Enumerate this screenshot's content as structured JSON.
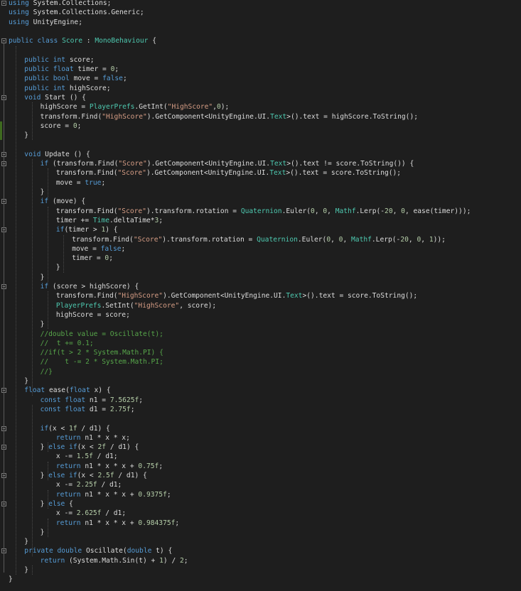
{
  "editor": {
    "language": "C#",
    "colors": {
      "background": "#1e1e1e",
      "keyword": "#569cd6",
      "type": "#4ec9b0",
      "string": "#d69d85",
      "number": "#b5cea8",
      "comment": "#57a64a",
      "plain": "#dcdcdc"
    },
    "lines": [
      {
        "indent": 0,
        "t": [
          [
            "kw",
            "using"
          ],
          [
            "pl",
            " System.Collections;"
          ]
        ]
      },
      {
        "indent": 0,
        "t": [
          [
            "kw",
            "using"
          ],
          [
            "pl",
            " System.Collections.Generic;"
          ]
        ]
      },
      {
        "indent": 0,
        "t": [
          [
            "kw",
            "using"
          ],
          [
            "pl",
            " UnityEngine;"
          ]
        ]
      },
      {
        "indent": 0,
        "t": []
      },
      {
        "indent": 0,
        "t": [
          [
            "kw",
            "public"
          ],
          [
            "pl",
            " "
          ],
          [
            "kw",
            "class"
          ],
          [
            "pl",
            " "
          ],
          [
            "ty",
            "Score"
          ],
          [
            "pl",
            " : "
          ],
          [
            "ty",
            "MonoBehaviour"
          ],
          [
            "pl",
            " {"
          ]
        ]
      },
      {
        "indent": 0,
        "t": []
      },
      {
        "indent": 1,
        "t": [
          [
            "kw",
            "public"
          ],
          [
            "pl",
            " "
          ],
          [
            "kw",
            "int"
          ],
          [
            "pl",
            " score;"
          ]
        ]
      },
      {
        "indent": 1,
        "t": [
          [
            "kw",
            "public"
          ],
          [
            "pl",
            " "
          ],
          [
            "kw",
            "float"
          ],
          [
            "pl",
            " timer = "
          ],
          [
            "nu",
            "0"
          ],
          [
            "pl",
            ";"
          ]
        ]
      },
      {
        "indent": 1,
        "t": [
          [
            "kw",
            "public"
          ],
          [
            "pl",
            " "
          ],
          [
            "kw",
            "bool"
          ],
          [
            "pl",
            " move = "
          ],
          [
            "kw",
            "false"
          ],
          [
            "pl",
            ";"
          ]
        ]
      },
      {
        "indent": 1,
        "t": [
          [
            "kw",
            "public"
          ],
          [
            "pl",
            " "
          ],
          [
            "kw",
            "int"
          ],
          [
            "pl",
            " highScore;"
          ]
        ]
      },
      {
        "indent": 1,
        "t": [
          [
            "kw",
            "void"
          ],
          [
            "pl",
            " Start () {"
          ]
        ]
      },
      {
        "indent": 2,
        "t": [
          [
            "pl",
            "highScore = "
          ],
          [
            "ty",
            "PlayerPrefs"
          ],
          [
            "pl",
            ".GetInt("
          ],
          [
            "st",
            "\"HighScore\""
          ],
          [
            "pl",
            ","
          ],
          [
            "nu",
            "0"
          ],
          [
            "pl",
            ");"
          ]
        ]
      },
      {
        "indent": 2,
        "t": [
          [
            "pl",
            "transform.Find("
          ],
          [
            "st",
            "\"HighScore\""
          ],
          [
            "pl",
            ").GetComponent<UnityEngine.UI."
          ],
          [
            "ty",
            "Text"
          ],
          [
            "pl",
            ">().text = highScore.ToString();"
          ]
        ]
      },
      {
        "indent": 2,
        "t": [
          [
            "pl",
            "score = "
          ],
          [
            "nu",
            "0"
          ],
          [
            "pl",
            ";"
          ]
        ]
      },
      {
        "indent": 1,
        "t": [
          [
            "pl",
            "}"
          ]
        ]
      },
      {
        "indent": 0,
        "t": []
      },
      {
        "indent": 1,
        "t": [
          [
            "kw",
            "void"
          ],
          [
            "pl",
            " Update () {"
          ]
        ]
      },
      {
        "indent": 2,
        "t": [
          [
            "kw",
            "if"
          ],
          [
            "pl",
            " (transform.Find("
          ],
          [
            "st",
            "\"Score\""
          ],
          [
            "pl",
            ").GetComponent<UnityEngine.UI."
          ],
          [
            "ty",
            "Text"
          ],
          [
            "pl",
            ">().text != score.ToString()) {"
          ]
        ]
      },
      {
        "indent": 3,
        "t": [
          [
            "pl",
            "transform.Find("
          ],
          [
            "st",
            "\"Score\""
          ],
          [
            "pl",
            ").GetComponent<UnityEngine.UI."
          ],
          [
            "ty",
            "Text"
          ],
          [
            "pl",
            ">().text = score.ToString();"
          ]
        ]
      },
      {
        "indent": 3,
        "t": [
          [
            "pl",
            "move = "
          ],
          [
            "kw",
            "true"
          ],
          [
            "pl",
            ";"
          ]
        ]
      },
      {
        "indent": 2,
        "t": [
          [
            "pl",
            "}"
          ]
        ]
      },
      {
        "indent": 2,
        "t": [
          [
            "kw",
            "if"
          ],
          [
            "pl",
            " (move) {"
          ]
        ]
      },
      {
        "indent": 3,
        "t": [
          [
            "pl",
            "transform.Find("
          ],
          [
            "st",
            "\"Score\""
          ],
          [
            "pl",
            ").transform.rotation = "
          ],
          [
            "ty",
            "Quaternion"
          ],
          [
            "pl",
            ".Euler("
          ],
          [
            "nu",
            "0"
          ],
          [
            "pl",
            ", "
          ],
          [
            "nu",
            "0"
          ],
          [
            "pl",
            ", "
          ],
          [
            "ty",
            "Mathf"
          ],
          [
            "pl",
            ".Lerp(-"
          ],
          [
            "nu",
            "20"
          ],
          [
            "pl",
            ", "
          ],
          [
            "nu",
            "0"
          ],
          [
            "pl",
            ", ease(timer)));"
          ]
        ]
      },
      {
        "indent": 3,
        "t": [
          [
            "pl",
            "timer += "
          ],
          [
            "ty",
            "Time"
          ],
          [
            "pl",
            ".deltaTime*"
          ],
          [
            "nu",
            "3"
          ],
          [
            "pl",
            ";"
          ]
        ]
      },
      {
        "indent": 3,
        "t": [
          [
            "kw",
            "if"
          ],
          [
            "pl",
            "(timer > "
          ],
          [
            "nu",
            "1"
          ],
          [
            "pl",
            ") {"
          ]
        ]
      },
      {
        "indent": 4,
        "t": [
          [
            "pl",
            "transform.Find("
          ],
          [
            "st",
            "\"Score\""
          ],
          [
            "pl",
            ").transform.rotation = "
          ],
          [
            "ty",
            "Quaternion"
          ],
          [
            "pl",
            ".Euler("
          ],
          [
            "nu",
            "0"
          ],
          [
            "pl",
            ", "
          ],
          [
            "nu",
            "0"
          ],
          [
            "pl",
            ", "
          ],
          [
            "ty",
            "Mathf"
          ],
          [
            "pl",
            ".Lerp(-"
          ],
          [
            "nu",
            "20"
          ],
          [
            "pl",
            ", "
          ],
          [
            "nu",
            "0"
          ],
          [
            "pl",
            ", "
          ],
          [
            "nu",
            "1"
          ],
          [
            "pl",
            "));"
          ]
        ]
      },
      {
        "indent": 4,
        "t": [
          [
            "pl",
            "move = "
          ],
          [
            "kw",
            "false"
          ],
          [
            "pl",
            ";"
          ]
        ]
      },
      {
        "indent": 4,
        "t": [
          [
            "pl",
            "timer = "
          ],
          [
            "nu",
            "0"
          ],
          [
            "pl",
            ";"
          ]
        ]
      },
      {
        "indent": 3,
        "t": [
          [
            "pl",
            "}"
          ]
        ]
      },
      {
        "indent": 2,
        "t": [
          [
            "pl",
            "}"
          ]
        ]
      },
      {
        "indent": 2,
        "t": [
          [
            "kw",
            "if"
          ],
          [
            "pl",
            " (score > highScore) {"
          ]
        ]
      },
      {
        "indent": 3,
        "t": [
          [
            "pl",
            "transform.Find("
          ],
          [
            "st",
            "\"HighScore\""
          ],
          [
            "pl",
            ").GetComponent<UnityEngine.UI."
          ],
          [
            "ty",
            "Text"
          ],
          [
            "pl",
            ">().text = score.ToString();"
          ]
        ]
      },
      {
        "indent": 3,
        "t": [
          [
            "ty",
            "PlayerPrefs"
          ],
          [
            "pl",
            ".SetInt("
          ],
          [
            "st",
            "\"HighScore\""
          ],
          [
            "pl",
            ", score);"
          ]
        ]
      },
      {
        "indent": 3,
        "t": [
          [
            "pl",
            "highScore = score;"
          ]
        ]
      },
      {
        "indent": 2,
        "t": [
          [
            "pl",
            "}"
          ]
        ]
      },
      {
        "indent": 2,
        "t": [
          [
            "cm",
            "//double value = Oscillate(t);"
          ]
        ]
      },
      {
        "indent": 2,
        "t": [
          [
            "cm",
            "//  t += 0.1;"
          ]
        ]
      },
      {
        "indent": 2,
        "t": [
          [
            "cm",
            "//if(t > 2 * System.Math.PI) {"
          ]
        ]
      },
      {
        "indent": 2,
        "t": [
          [
            "cm",
            "//    t -= 2 * System.Math.PI;"
          ]
        ]
      },
      {
        "indent": 2,
        "t": [
          [
            "cm",
            "//}"
          ]
        ]
      },
      {
        "indent": 1,
        "t": [
          [
            "pl",
            "}"
          ]
        ]
      },
      {
        "indent": 1,
        "t": [
          [
            "kw",
            "float"
          ],
          [
            "pl",
            " ease("
          ],
          [
            "kw",
            "float"
          ],
          [
            "pl",
            " x) {"
          ]
        ]
      },
      {
        "indent": 2,
        "t": [
          [
            "kw",
            "const"
          ],
          [
            "pl",
            " "
          ],
          [
            "kw",
            "float"
          ],
          [
            "pl",
            " n1 = "
          ],
          [
            "nu",
            "7.5625f"
          ],
          [
            "pl",
            ";"
          ]
        ]
      },
      {
        "indent": 2,
        "t": [
          [
            "kw",
            "const"
          ],
          [
            "pl",
            " "
          ],
          [
            "kw",
            "float"
          ],
          [
            "pl",
            " d1 = "
          ],
          [
            "nu",
            "2.75f"
          ],
          [
            "pl",
            ";"
          ]
        ]
      },
      {
        "indent": 0,
        "t": []
      },
      {
        "indent": 2,
        "t": [
          [
            "kw",
            "if"
          ],
          [
            "pl",
            "(x < "
          ],
          [
            "nu",
            "1f"
          ],
          [
            "pl",
            " / d1) {"
          ]
        ]
      },
      {
        "indent": 3,
        "t": [
          [
            "kw",
            "return"
          ],
          [
            "pl",
            " n1 * x * x;"
          ]
        ]
      },
      {
        "indent": 2,
        "t": [
          [
            "pl",
            "} "
          ],
          [
            "kw",
            "else"
          ],
          [
            "pl",
            " "
          ],
          [
            "kw",
            "if"
          ],
          [
            "pl",
            "(x < "
          ],
          [
            "nu",
            "2f"
          ],
          [
            "pl",
            " / d1) {"
          ]
        ]
      },
      {
        "indent": 3,
        "t": [
          [
            "pl",
            "x -= "
          ],
          [
            "nu",
            "1.5f"
          ],
          [
            "pl",
            " / d1;"
          ]
        ]
      },
      {
        "indent": 3,
        "t": [
          [
            "kw",
            "return"
          ],
          [
            "pl",
            " n1 * x * x + "
          ],
          [
            "nu",
            "0.75f"
          ],
          [
            "pl",
            ";"
          ]
        ]
      },
      {
        "indent": 2,
        "t": [
          [
            "pl",
            "} "
          ],
          [
            "kw",
            "else"
          ],
          [
            "pl",
            " "
          ],
          [
            "kw",
            "if"
          ],
          [
            "pl",
            "(x < "
          ],
          [
            "nu",
            "2.5f"
          ],
          [
            "pl",
            " / d1) {"
          ]
        ]
      },
      {
        "indent": 3,
        "t": [
          [
            "pl",
            "x -= "
          ],
          [
            "nu",
            "2.25f"
          ],
          [
            "pl",
            " / d1;"
          ]
        ]
      },
      {
        "indent": 3,
        "t": [
          [
            "kw",
            "return"
          ],
          [
            "pl",
            " n1 * x * x + "
          ],
          [
            "nu",
            "0.9375f"
          ],
          [
            "pl",
            ";"
          ]
        ]
      },
      {
        "indent": 2,
        "t": [
          [
            "pl",
            "} "
          ],
          [
            "kw",
            "else"
          ],
          [
            "pl",
            " {"
          ]
        ]
      },
      {
        "indent": 3,
        "t": [
          [
            "pl",
            "x -= "
          ],
          [
            "nu",
            "2.625f"
          ],
          [
            "pl",
            " / d1;"
          ]
        ]
      },
      {
        "indent": 3,
        "t": [
          [
            "kw",
            "return"
          ],
          [
            "pl",
            " n1 * x * x + "
          ],
          [
            "nu",
            "0.984375f"
          ],
          [
            "pl",
            ";"
          ]
        ]
      },
      {
        "indent": 2,
        "t": [
          [
            "pl",
            "}"
          ]
        ]
      },
      {
        "indent": 1,
        "t": [
          [
            "pl",
            "}"
          ]
        ]
      },
      {
        "indent": 1,
        "t": [
          [
            "kw",
            "private"
          ],
          [
            "pl",
            " "
          ],
          [
            "kw",
            "double"
          ],
          [
            "pl",
            " Oscillate("
          ],
          [
            "kw",
            "double"
          ],
          [
            "pl",
            " t) {"
          ]
        ]
      },
      {
        "indent": 2,
        "t": [
          [
            "kw",
            "return"
          ],
          [
            "pl",
            " (System.Math.Sin(t) + "
          ],
          [
            "nu",
            "1"
          ],
          [
            "pl",
            ") / "
          ],
          [
            "nu",
            "2"
          ],
          [
            "pl",
            ";"
          ]
        ]
      },
      {
        "indent": 1,
        "t": [
          [
            "pl",
            "}"
          ]
        ]
      },
      {
        "indent": 0,
        "t": [
          [
            "pl",
            "}"
          ]
        ]
      }
    ]
  }
}
